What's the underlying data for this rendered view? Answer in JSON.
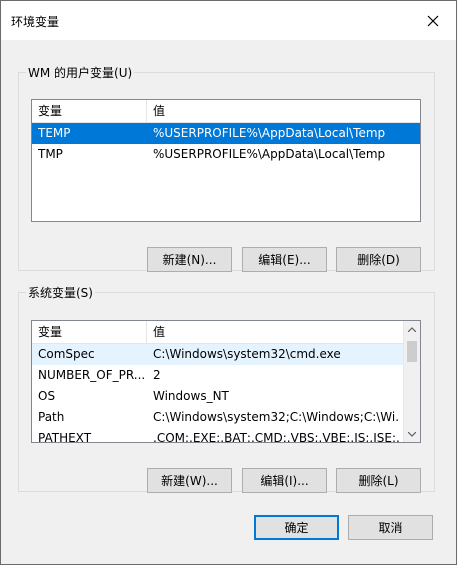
{
  "window": {
    "title": "环境变量"
  },
  "user_group": {
    "title": "WM 的用户变量(U)",
    "columns": [
      "变量",
      "值"
    ],
    "rows": [
      {
        "name": "TEMP",
        "value": "%USERPROFILE%\\AppData\\Local\\Temp",
        "selected": true
      },
      {
        "name": "TMP",
        "value": "%USERPROFILE%\\AppData\\Local\\Temp"
      }
    ],
    "buttons": {
      "new": "新建(N)...",
      "edit": "编辑(E)...",
      "delete": "删除(D)"
    }
  },
  "system_group": {
    "title": "系统变量(S)",
    "columns": [
      "变量",
      "值"
    ],
    "rows": [
      {
        "name": "ComSpec",
        "value": "C:\\Windows\\system32\\cmd.exe"
      },
      {
        "name": "NUMBER_OF_PR...",
        "value": "2"
      },
      {
        "name": "OS",
        "value": "Windows_NT"
      },
      {
        "name": "Path",
        "value": "C:\\Windows\\system32;C:\\Windows;C:\\Wi..."
      },
      {
        "name": "PATHEXT",
        "value": ".COM;.EXE;.BAT;.CMD;.VBS;.VBE;.JS;.JSE;..."
      }
    ],
    "buttons": {
      "new": "新建(W)...",
      "edit": "编辑(I)...",
      "delete": "删除(L)"
    }
  },
  "footer": {
    "ok": "确定",
    "cancel": "取消"
  },
  "colors": {
    "selection": "#0078d7",
    "hover": "#e5f3ff",
    "button_face": "#e1e1e1"
  }
}
